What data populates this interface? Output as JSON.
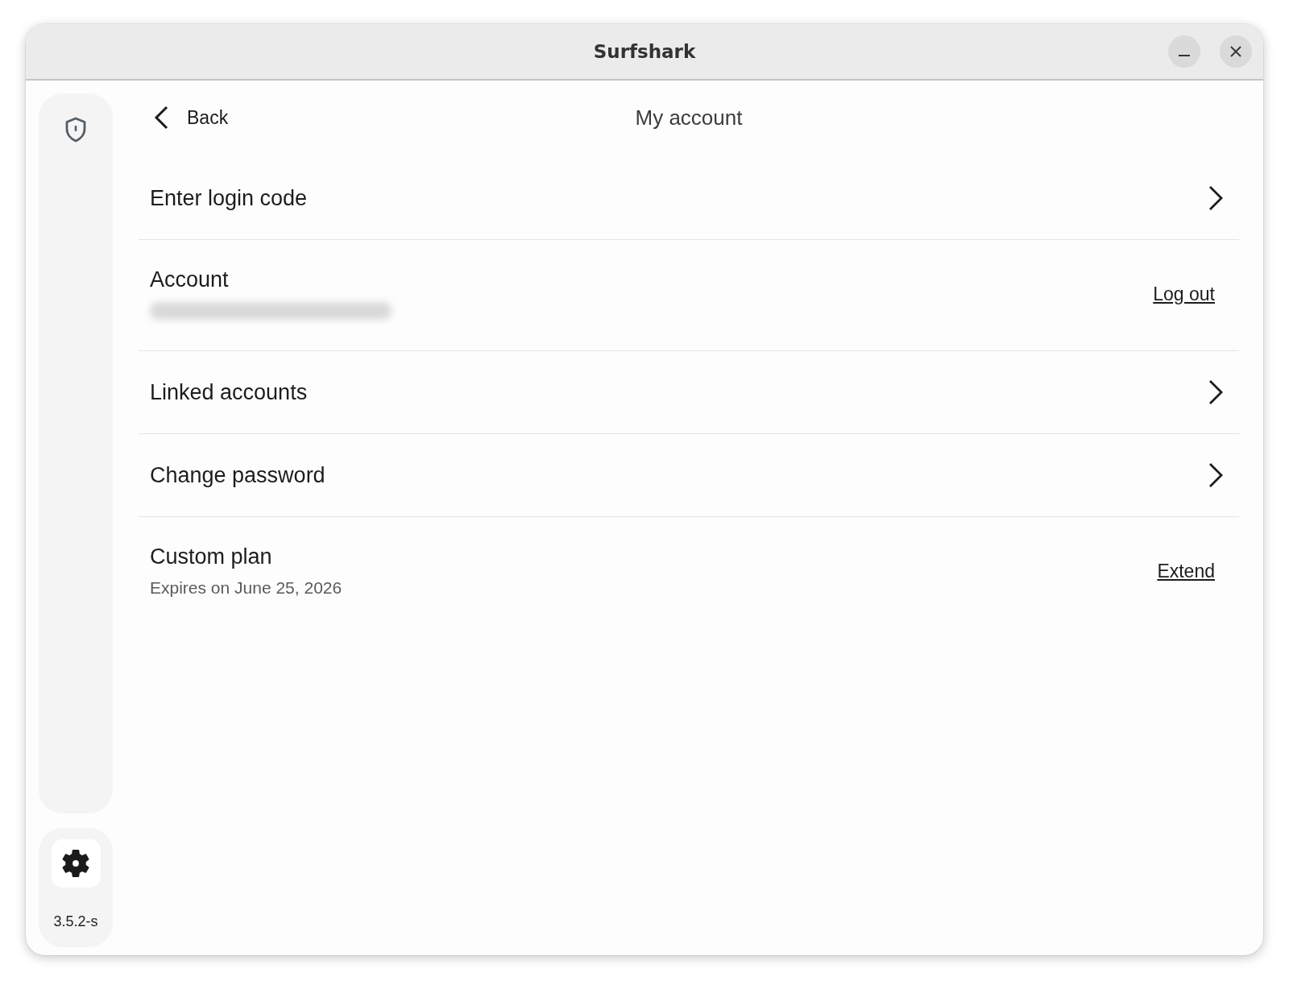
{
  "window": {
    "title": "Surfshark"
  },
  "sidebar": {
    "version": "3.5.2-s"
  },
  "header": {
    "back_label": "Back",
    "title": "My account"
  },
  "rows": [
    {
      "kind": "link",
      "label": "Enter login code"
    },
    {
      "kind": "detail",
      "label": "Account",
      "value_blurred": true,
      "action": "Log out"
    },
    {
      "kind": "link",
      "label": "Linked accounts"
    },
    {
      "kind": "link",
      "label": "Change password"
    },
    {
      "kind": "detail",
      "label": "Custom plan",
      "subtitle": "Expires on June 25, 2026",
      "action": "Extend"
    }
  ]
}
